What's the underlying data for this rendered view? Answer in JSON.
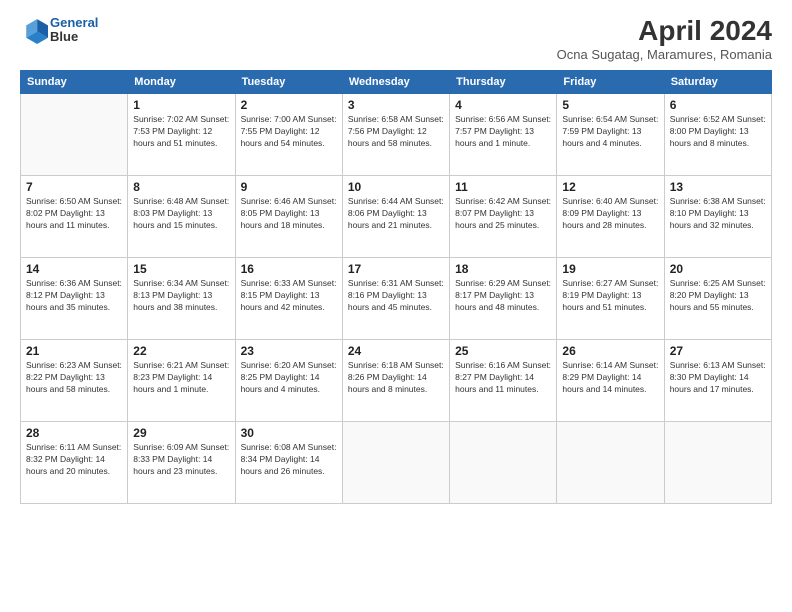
{
  "header": {
    "logo_line1": "General",
    "logo_line2": "Blue",
    "month": "April 2024",
    "location": "Ocna Sugatag, Maramures, Romania"
  },
  "weekdays": [
    "Sunday",
    "Monday",
    "Tuesday",
    "Wednesday",
    "Thursday",
    "Friday",
    "Saturday"
  ],
  "weeks": [
    [
      {
        "day": "",
        "info": ""
      },
      {
        "day": "1",
        "info": "Sunrise: 7:02 AM\nSunset: 7:53 PM\nDaylight: 12 hours\nand 51 minutes."
      },
      {
        "day": "2",
        "info": "Sunrise: 7:00 AM\nSunset: 7:55 PM\nDaylight: 12 hours\nand 54 minutes."
      },
      {
        "day": "3",
        "info": "Sunrise: 6:58 AM\nSunset: 7:56 PM\nDaylight: 12 hours\nand 58 minutes."
      },
      {
        "day": "4",
        "info": "Sunrise: 6:56 AM\nSunset: 7:57 PM\nDaylight: 13 hours\nand 1 minute."
      },
      {
        "day": "5",
        "info": "Sunrise: 6:54 AM\nSunset: 7:59 PM\nDaylight: 13 hours\nand 4 minutes."
      },
      {
        "day": "6",
        "info": "Sunrise: 6:52 AM\nSunset: 8:00 PM\nDaylight: 13 hours\nand 8 minutes."
      }
    ],
    [
      {
        "day": "7",
        "info": "Sunrise: 6:50 AM\nSunset: 8:02 PM\nDaylight: 13 hours\nand 11 minutes."
      },
      {
        "day": "8",
        "info": "Sunrise: 6:48 AM\nSunset: 8:03 PM\nDaylight: 13 hours\nand 15 minutes."
      },
      {
        "day": "9",
        "info": "Sunrise: 6:46 AM\nSunset: 8:05 PM\nDaylight: 13 hours\nand 18 minutes."
      },
      {
        "day": "10",
        "info": "Sunrise: 6:44 AM\nSunset: 8:06 PM\nDaylight: 13 hours\nand 21 minutes."
      },
      {
        "day": "11",
        "info": "Sunrise: 6:42 AM\nSunset: 8:07 PM\nDaylight: 13 hours\nand 25 minutes."
      },
      {
        "day": "12",
        "info": "Sunrise: 6:40 AM\nSunset: 8:09 PM\nDaylight: 13 hours\nand 28 minutes."
      },
      {
        "day": "13",
        "info": "Sunrise: 6:38 AM\nSunset: 8:10 PM\nDaylight: 13 hours\nand 32 minutes."
      }
    ],
    [
      {
        "day": "14",
        "info": "Sunrise: 6:36 AM\nSunset: 8:12 PM\nDaylight: 13 hours\nand 35 minutes."
      },
      {
        "day": "15",
        "info": "Sunrise: 6:34 AM\nSunset: 8:13 PM\nDaylight: 13 hours\nand 38 minutes."
      },
      {
        "day": "16",
        "info": "Sunrise: 6:33 AM\nSunset: 8:15 PM\nDaylight: 13 hours\nand 42 minutes."
      },
      {
        "day": "17",
        "info": "Sunrise: 6:31 AM\nSunset: 8:16 PM\nDaylight: 13 hours\nand 45 minutes."
      },
      {
        "day": "18",
        "info": "Sunrise: 6:29 AM\nSunset: 8:17 PM\nDaylight: 13 hours\nand 48 minutes."
      },
      {
        "day": "19",
        "info": "Sunrise: 6:27 AM\nSunset: 8:19 PM\nDaylight: 13 hours\nand 51 minutes."
      },
      {
        "day": "20",
        "info": "Sunrise: 6:25 AM\nSunset: 8:20 PM\nDaylight: 13 hours\nand 55 minutes."
      }
    ],
    [
      {
        "day": "21",
        "info": "Sunrise: 6:23 AM\nSunset: 8:22 PM\nDaylight: 13 hours\nand 58 minutes."
      },
      {
        "day": "22",
        "info": "Sunrise: 6:21 AM\nSunset: 8:23 PM\nDaylight: 14 hours\nand 1 minute."
      },
      {
        "day": "23",
        "info": "Sunrise: 6:20 AM\nSunset: 8:25 PM\nDaylight: 14 hours\nand 4 minutes."
      },
      {
        "day": "24",
        "info": "Sunrise: 6:18 AM\nSunset: 8:26 PM\nDaylight: 14 hours\nand 8 minutes."
      },
      {
        "day": "25",
        "info": "Sunrise: 6:16 AM\nSunset: 8:27 PM\nDaylight: 14 hours\nand 11 minutes."
      },
      {
        "day": "26",
        "info": "Sunrise: 6:14 AM\nSunset: 8:29 PM\nDaylight: 14 hours\nand 14 minutes."
      },
      {
        "day": "27",
        "info": "Sunrise: 6:13 AM\nSunset: 8:30 PM\nDaylight: 14 hours\nand 17 minutes."
      }
    ],
    [
      {
        "day": "28",
        "info": "Sunrise: 6:11 AM\nSunset: 8:32 PM\nDaylight: 14 hours\nand 20 minutes."
      },
      {
        "day": "29",
        "info": "Sunrise: 6:09 AM\nSunset: 8:33 PM\nDaylight: 14 hours\nand 23 minutes."
      },
      {
        "day": "30",
        "info": "Sunrise: 6:08 AM\nSunset: 8:34 PM\nDaylight: 14 hours\nand 26 minutes."
      },
      {
        "day": "",
        "info": ""
      },
      {
        "day": "",
        "info": ""
      },
      {
        "day": "",
        "info": ""
      },
      {
        "day": "",
        "info": ""
      }
    ]
  ]
}
